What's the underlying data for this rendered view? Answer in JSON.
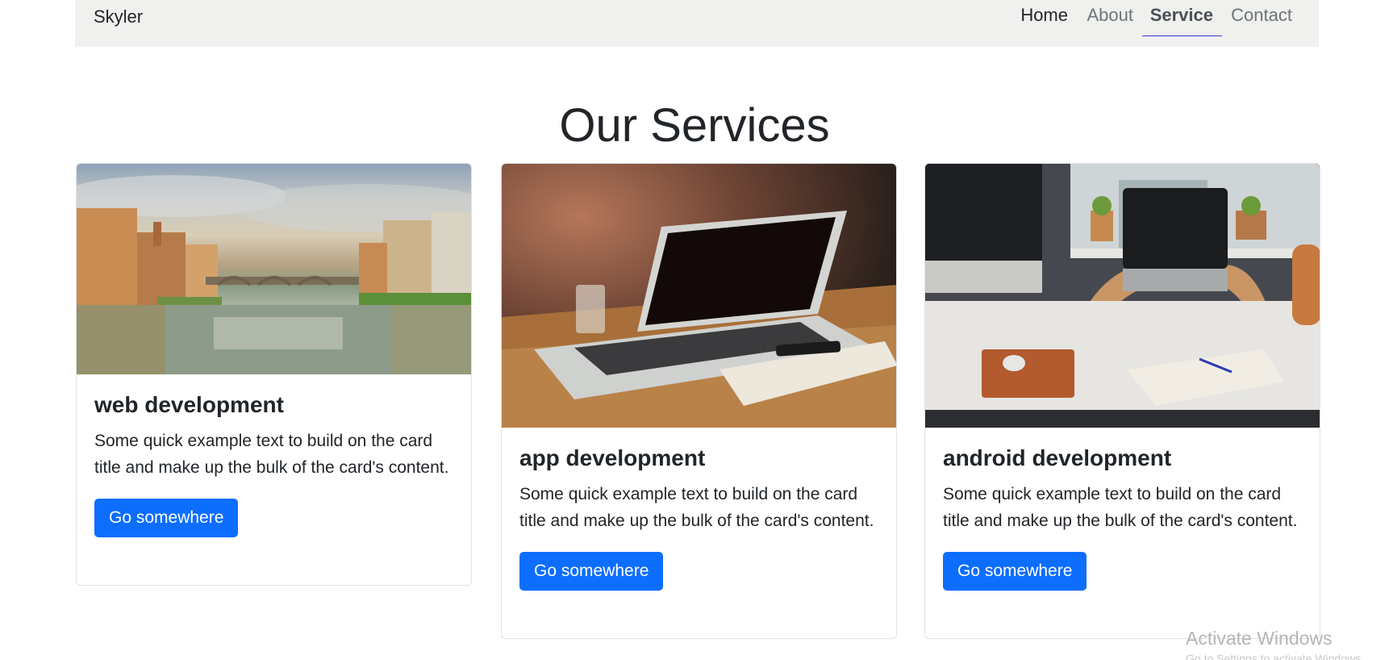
{
  "navbar": {
    "brand": "Skyler",
    "links": [
      {
        "label": "Home"
      },
      {
        "label": "About"
      },
      {
        "label": "Service"
      },
      {
        "label": "Contact"
      }
    ]
  },
  "section": {
    "title": "Our Services"
  },
  "cards": [
    {
      "title": "web development",
      "text": "Some quick example text to build on the card title and make up the bulk of the card's content.",
      "button": "Go somewhere"
    },
    {
      "title": "app development",
      "text": "Some quick example text to build on the card title and make up the bulk of the card's content.",
      "button": "Go somewhere"
    },
    {
      "title": "android development",
      "text": "Some quick example text to build on the card title and make up the bulk of the card's content.",
      "button": "Go somewhere"
    }
  ],
  "watermark": {
    "line1": "Activate Windows",
    "line2": "Go to Settings to activate Windows."
  },
  "colors": {
    "primary": "#0d6efd",
    "navbar_bg": "#f0f0ee",
    "active_underline": "#3b3bd6"
  }
}
